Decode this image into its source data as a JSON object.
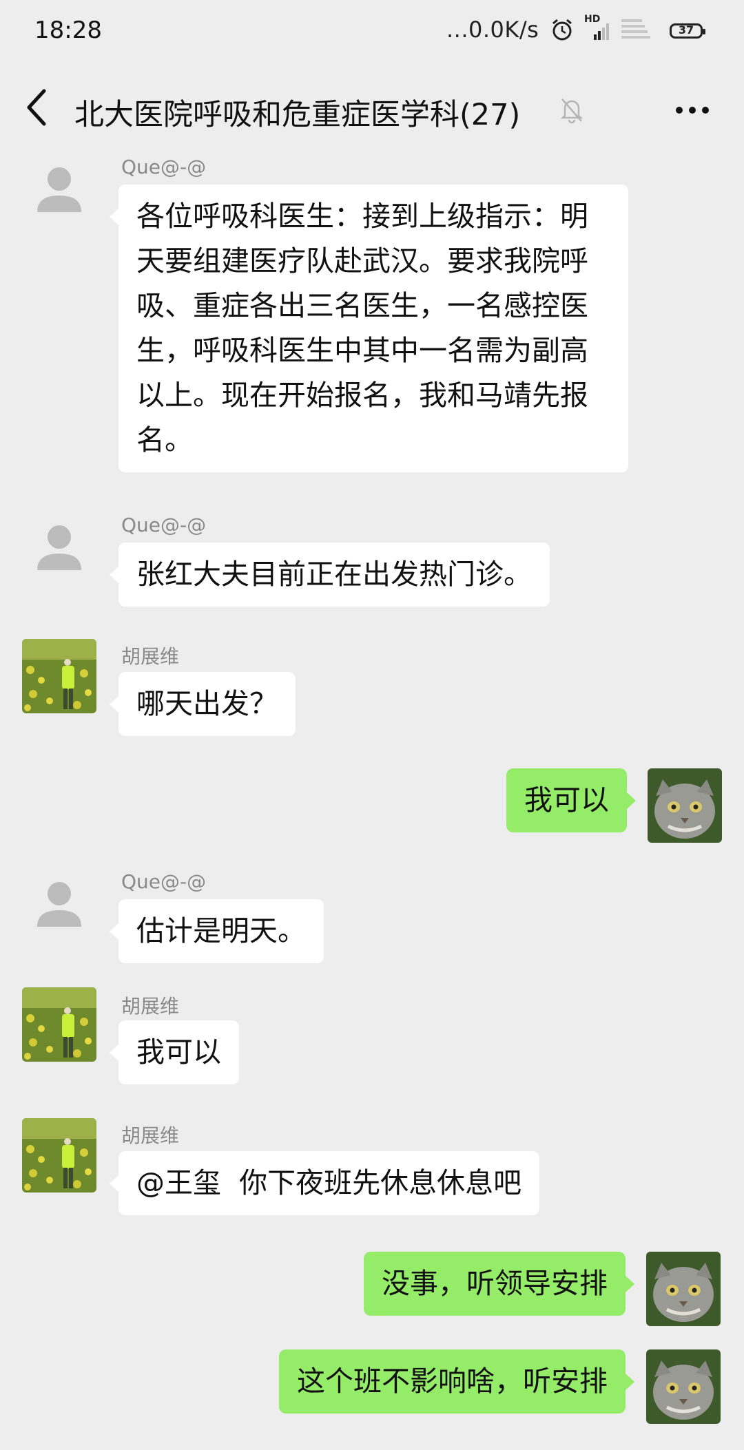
{
  "status_bar": {
    "time": "18:28",
    "network_speed": "...0.0K/s",
    "hd_label": "HD",
    "battery": "37"
  },
  "nav": {
    "title": "北大医院呼吸和危重症医学科(27)"
  },
  "messages": [
    {
      "side": "left",
      "avatar": "default-avatar-icon",
      "sender": "Que@-@",
      "text": "各位呼吸科医生：接到上级指示：明天要组建医疗队赴武汉。要求我院呼吸、重症各出三名医生，一名感控医生，呼吸科医生中其中一名需为副高以上。现在开始报名，我和马靖先报名。"
    },
    {
      "side": "left",
      "avatar": "default-avatar-icon",
      "sender": "Que@-@",
      "text": "张红大夫目前正在出发热门诊。"
    },
    {
      "side": "left",
      "avatar": "field-photo-avatar",
      "sender": "胡展维",
      "text": "哪天出发？"
    },
    {
      "side": "right",
      "avatar": "cat-avatar",
      "text": "我可以"
    },
    {
      "side": "left",
      "avatar": "default-avatar-icon",
      "sender": "Que@-@",
      "text": "估计是明天。"
    },
    {
      "side": "left",
      "avatar": "field-photo-avatar",
      "sender": "胡展维",
      "text": "我可以"
    },
    {
      "side": "left",
      "avatar": "field-photo-avatar",
      "sender": "胡展维",
      "text": "@王玺  你下夜班先休息休息吧"
    },
    {
      "side": "right",
      "avatar": "cat-avatar",
      "text": "没事，听领导安排"
    },
    {
      "side": "right",
      "avatar": "cat-avatar",
      "text": "这个班不影响啥，听安排"
    }
  ],
  "colors": {
    "background": "#ededed",
    "bubble_self": "#95ec69",
    "bubble_other": "#ffffff",
    "sender_name": "#8a8a8a"
  }
}
